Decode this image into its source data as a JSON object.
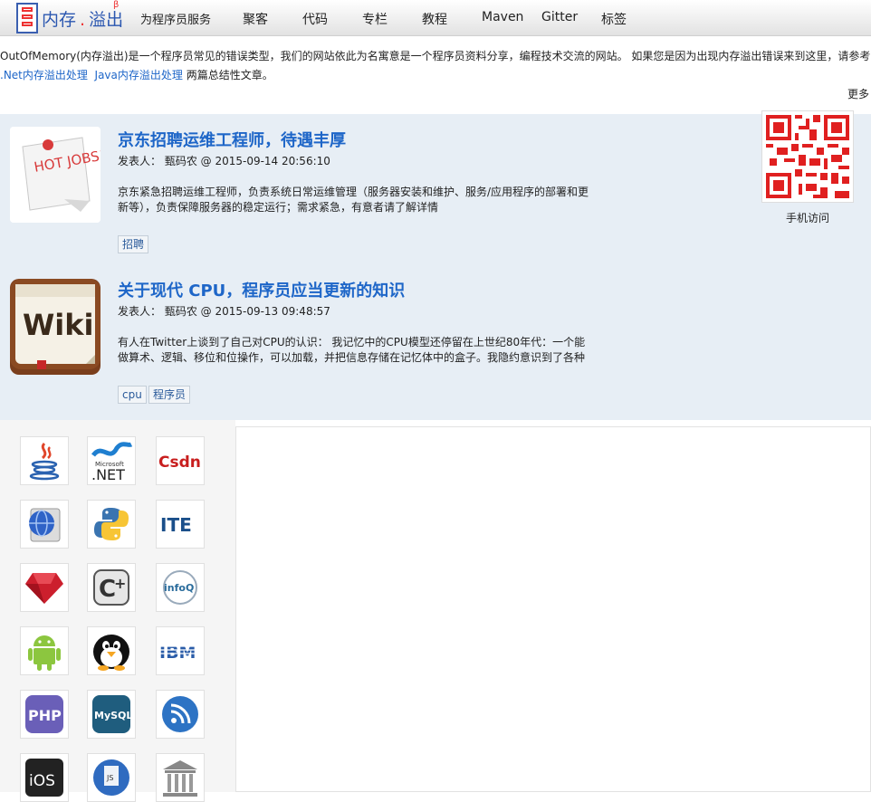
{
  "header": {
    "logo_text_left": "内存",
    "logo_dot": ".",
    "logo_text_right": "溢出",
    "logo_beta": "β",
    "slogan": "为程序员服务",
    "nav": [
      "聚客",
      "代码",
      "专栏",
      "教程",
      "Maven",
      "Gitter",
      "标签"
    ]
  },
  "intro": {
    "text_1": "OutOfMemory(内存溢出)是一个程序员常见的错误类型，我们的网站依此为名寓意是一个程序员资料分享，编程技术交流的网站。 如果您是因为出现内存溢出错误来到这里，请参考 ",
    "link_net": ".Net内存溢出处理",
    "link_java": "Java内存溢出处理",
    "text_2": " 两篇总结性文章。",
    "more": "更多"
  },
  "posts": [
    {
      "title": "京东招聘运维工程师，待遇丰厚",
      "meta": "发表人：  甄码农  @ 2015-09-14 20:56:10",
      "body": "京东紧急招聘运维工程师，负责系统日常运维管理（服务器安装和维护、服务/应用程序的部署和更新等），负责保障服务器的稳定运行；需求紧急，有意者请了解详情",
      "tags": [
        "招聘"
      ],
      "thumb_text": "HOT JOBS!"
    },
    {
      "title": "关于现代 CPU，程序员应当更新的知识",
      "meta": "发表人：  甄码农  @ 2015-09-13 09:48:57",
      "body": "有人在Twitter上谈到了自己对CPU的认识： 我记忆中的CPU模型还停留在上世纪80年代：一个能做算术、逻辑、移位和位操作，可以加载，并把信息存储在记忆体中的盒子。我隐约意识到了各种",
      "tags": [
        "cpu",
        "程序员"
      ],
      "thumb_text": "Wiki"
    }
  ],
  "qr": {
    "caption": "手机访问"
  },
  "categories": {
    "net_top": "Microsoft",
    "net": ".NET",
    "csdn": "Csdn",
    "ite": "ITE",
    "infoq": "infoQ",
    "ibm": "IBM",
    "php": "PHP",
    "mysql": "MySQL",
    "ios": "iOS",
    "js": "JS"
  },
  "colors": {
    "link": "#1e66c8",
    "posts_bg": "#e7eef5",
    "accent_red": "#e33333"
  }
}
